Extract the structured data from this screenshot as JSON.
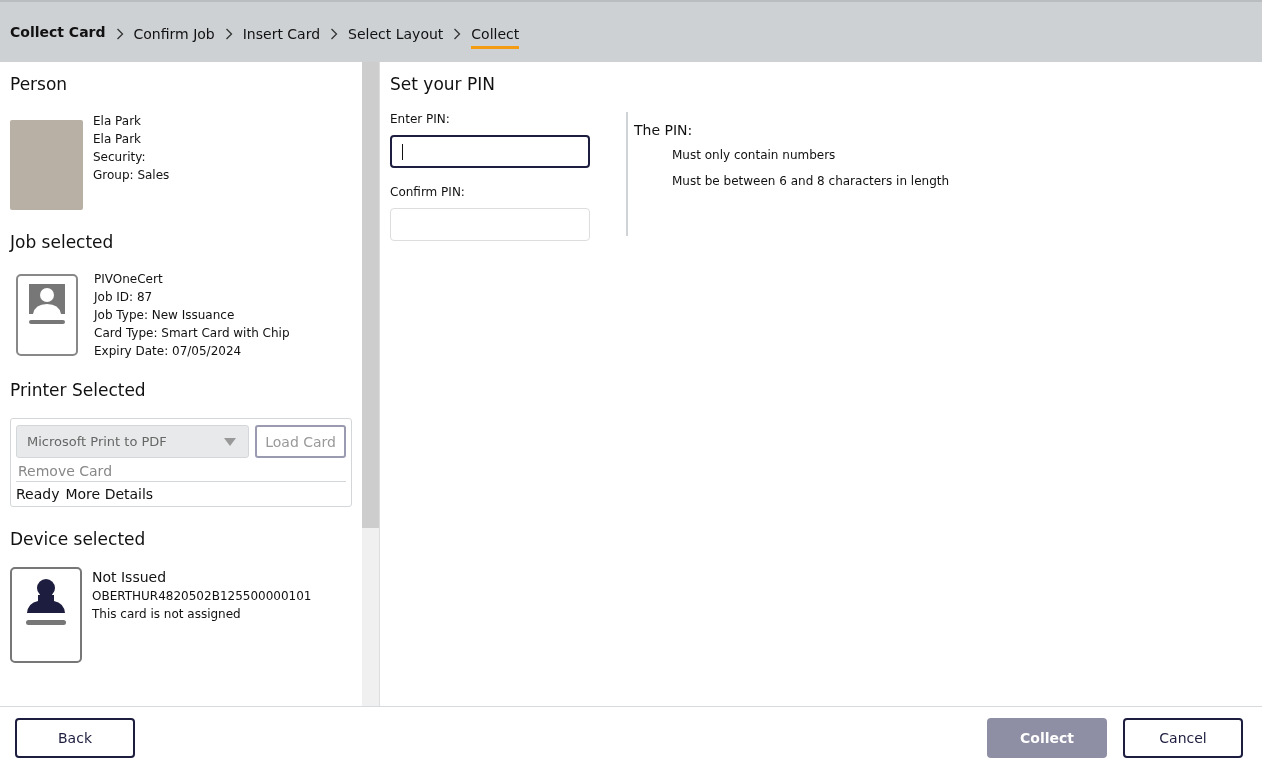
{
  "breadcrumb": {
    "title": "Collect Card",
    "steps": [
      {
        "label": "Confirm Job",
        "selected": false
      },
      {
        "label": "Insert Card",
        "selected": false
      },
      {
        "label": "Select Layout",
        "selected": false
      },
      {
        "label": "Collect",
        "selected": true
      }
    ]
  },
  "person": {
    "heading": "Person",
    "lines": [
      "Ela Park",
      "Ela Park",
      "Security:",
      "Group: Sales"
    ]
  },
  "job": {
    "heading": "Job selected",
    "lines": [
      "PIVOneCert",
      "Job ID: 87",
      "Job Type: New Issuance",
      "Card Type: Smart Card with Chip",
      "Expiry Date: 07/05/2024"
    ]
  },
  "printer": {
    "heading": "Printer Selected",
    "select": {
      "value": "Microsoft Print to PDF",
      "disabled": true
    },
    "load_button": {
      "label": "Load Card",
      "disabled": true
    },
    "remove_link": {
      "label": "Remove Card",
      "disabled": true
    },
    "status": "Ready",
    "details_link": "More Details"
  },
  "device": {
    "heading": "Device selected",
    "status": "Not Issued",
    "serial": "OBERTHUR4820502B125500000101",
    "note": "This card is not assigned"
  },
  "pin": {
    "heading": "Set your PIN",
    "fields": [
      {
        "label": "Enter PIN:",
        "focused": true
      },
      {
        "label": "Confirm PIN:",
        "focused": false
      }
    ],
    "rules_title": "The PIN:",
    "rules": [
      "Must only contain numbers",
      "Must be between 6 and 8 characters in length"
    ]
  },
  "footer": {
    "buttons": [
      {
        "label": "Back",
        "kind": "outline",
        "disabled": false
      },
      {
        "label": "Collect",
        "kind": "primary",
        "disabled": true
      },
      {
        "label": "Cancel",
        "kind": "outline",
        "disabled": false
      }
    ]
  }
}
